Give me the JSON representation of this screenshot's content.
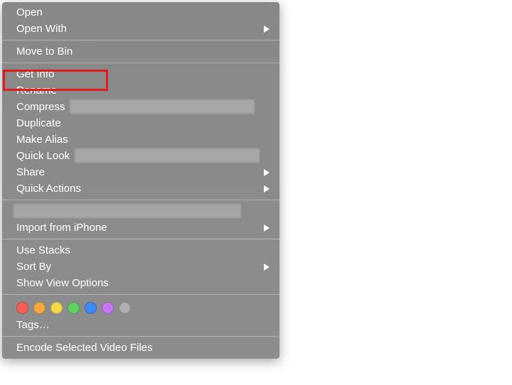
{
  "menu": {
    "group1": [
      {
        "label": "Open",
        "submenu": false
      },
      {
        "label": "Open With",
        "submenu": true
      }
    ],
    "group2": [
      {
        "label": "Move to Bin",
        "submenu": false
      }
    ],
    "group3": [
      {
        "label": "Get Info",
        "submenu": false,
        "highlighted": true
      },
      {
        "label": "Rename",
        "submenu": false
      },
      {
        "label": "Compress",
        "submenu": false,
        "redacted": true
      },
      {
        "label": "Duplicate",
        "submenu": false
      },
      {
        "label": "Make Alias",
        "submenu": false
      },
      {
        "label": "Quick Look",
        "submenu": false,
        "redacted": true
      },
      {
        "label": "Share",
        "submenu": true
      },
      {
        "label": "Quick Actions",
        "submenu": true
      }
    ],
    "group4": [
      {
        "label": "",
        "submenu": false,
        "redacted_full": true
      },
      {
        "label": "Import from iPhone",
        "submenu": true
      }
    ],
    "group5": [
      {
        "label": "Use Stacks",
        "submenu": false
      },
      {
        "label": "Sort By",
        "submenu": true
      },
      {
        "label": "Show View Options",
        "submenu": false
      }
    ],
    "tags_label": "Tags…",
    "group6": [
      {
        "label": "Encode Selected Video Files",
        "submenu": false
      }
    ]
  },
  "tags": {
    "colors": [
      "#fb5f57",
      "#f9a93f",
      "#f6d94b",
      "#60d162",
      "#3e8bff",
      "#c678f2",
      "#b0b0b0"
    ]
  }
}
